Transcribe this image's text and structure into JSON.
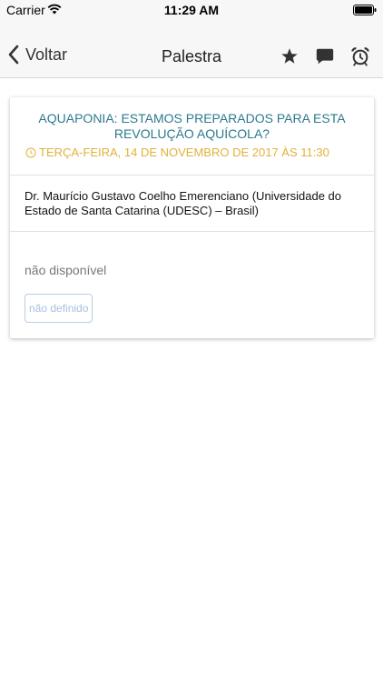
{
  "status_bar": {
    "carrier": "Carrier",
    "time": "11:29 AM"
  },
  "nav": {
    "back_label": "Voltar",
    "title": "Palestra",
    "icons": [
      "star-icon",
      "chat-icon",
      "alarm-clock-icon"
    ]
  },
  "talk": {
    "title": "AQUAPONIA: ESTAMOS PREPARADOS PARA ESTA REVOLUÇÃO AQUÍCOLA?",
    "datetime": "TERÇA-FEIRA, 14 DE NOVEMBRO DE 2017 ÀS 11:30",
    "speaker": "Dr. Maurício Gustavo Coelho Emerenciano (Universidade do Estado de Santa Catarina (UDESC) – Brasil)",
    "availability": "não disponível",
    "status_chip": "não definido"
  },
  "colors": {
    "title": "#2b7a8e",
    "date": "#e0b23b",
    "chip_border": "#b7cde8"
  }
}
